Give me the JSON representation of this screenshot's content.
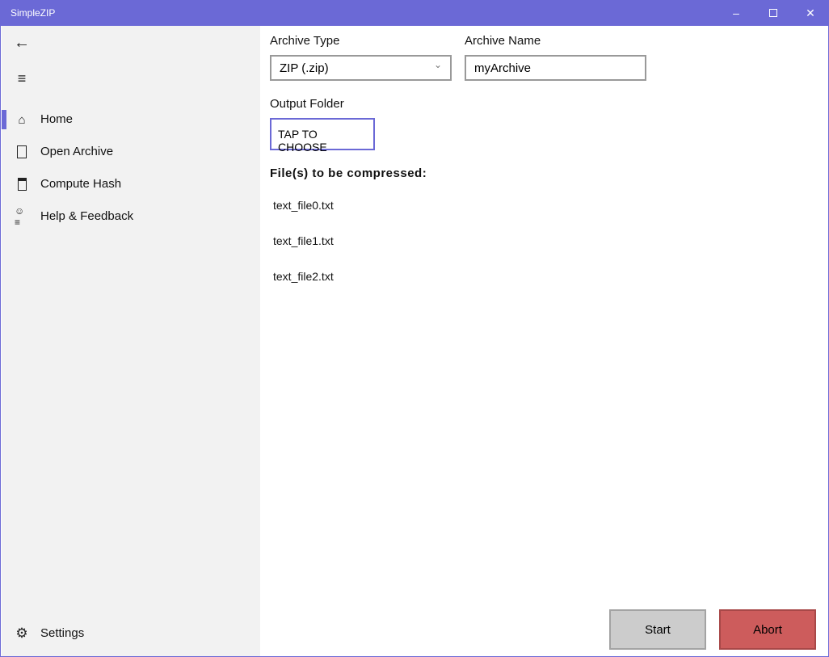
{
  "app": {
    "title": "SimpleZIP"
  },
  "nav": {
    "items": [
      {
        "label": "Home"
      },
      {
        "label": "Open Archive"
      },
      {
        "label": "Compute Hash"
      },
      {
        "label": "Help & Feedback"
      }
    ],
    "settings": "Settings"
  },
  "form": {
    "archive_type_label": "Archive Type",
    "archive_type_value": "ZIP (.zip)",
    "archive_name_label": "Archive Name",
    "archive_name_value": "myArchive",
    "output_folder_label": "Output Folder",
    "choose_button": "TAP TO CHOOSE",
    "files_heading": "File(s) to be compressed:",
    "files": [
      "text_file0.txt",
      "text_file1.txt",
      "text_file2.txt"
    ]
  },
  "actions": {
    "start": "Start",
    "abort": "Abort"
  },
  "colors": {
    "accent": "#6b69d6",
    "abort": "#cd5c5c"
  }
}
